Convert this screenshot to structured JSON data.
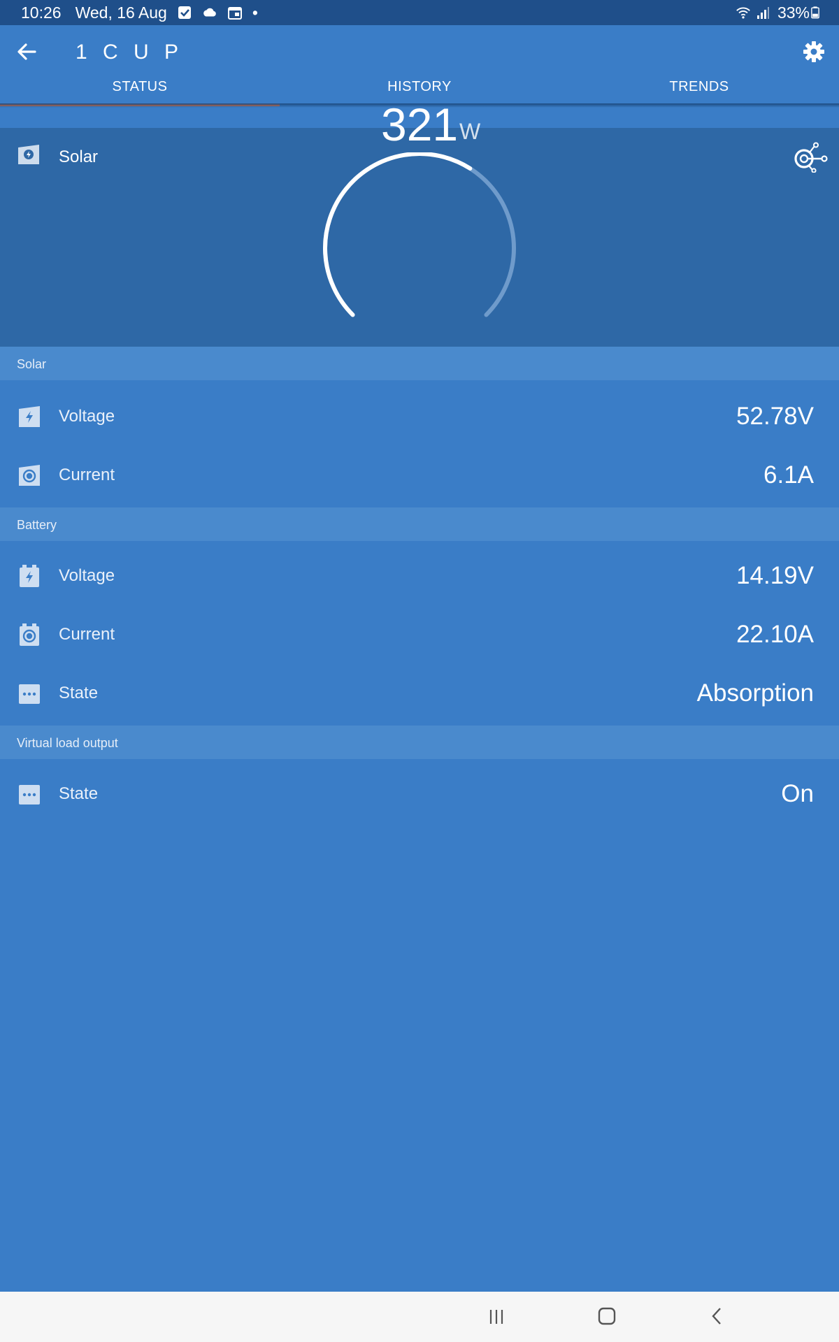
{
  "status_bar": {
    "time": "10:26",
    "date": "Wed, 16 Aug",
    "dot": "•",
    "battery": "33%"
  },
  "app_bar": {
    "title": "1 C U P"
  },
  "tabs": [
    {
      "label": "STATUS",
      "active": true
    },
    {
      "label": "HISTORY",
      "active": false
    },
    {
      "label": "TRENDS",
      "active": false
    }
  ],
  "hero": {
    "label": "Solar",
    "power_value": "321",
    "power_unit": "W",
    "gauge_fraction": 0.62
  },
  "sections": {
    "solar": {
      "header": "Solar",
      "rows": [
        {
          "label": "Voltage",
          "value": "52.78V",
          "icon": "solar-voltage-icon"
        },
        {
          "label": "Current",
          "value": "6.1A",
          "icon": "solar-current-icon"
        }
      ]
    },
    "battery": {
      "header": "Battery",
      "rows": [
        {
          "label": "Voltage",
          "value": "14.19V",
          "icon": "battery-voltage-icon"
        },
        {
          "label": "Current",
          "value": "22.10A",
          "icon": "battery-current-icon"
        },
        {
          "label": "State",
          "value": "Absorption",
          "icon": "state-icon"
        }
      ]
    },
    "virtual_load": {
      "header": "Virtual load output",
      "rows": [
        {
          "label": "State",
          "value": "On",
          "icon": "state-icon"
        }
      ]
    }
  },
  "colors": {
    "background": "#3a7dc7",
    "hero_background": "#2e68a6",
    "section_header": "#4a8acd",
    "tab_indicator": "#e8733c",
    "status_bar": "#1f4f8a"
  }
}
